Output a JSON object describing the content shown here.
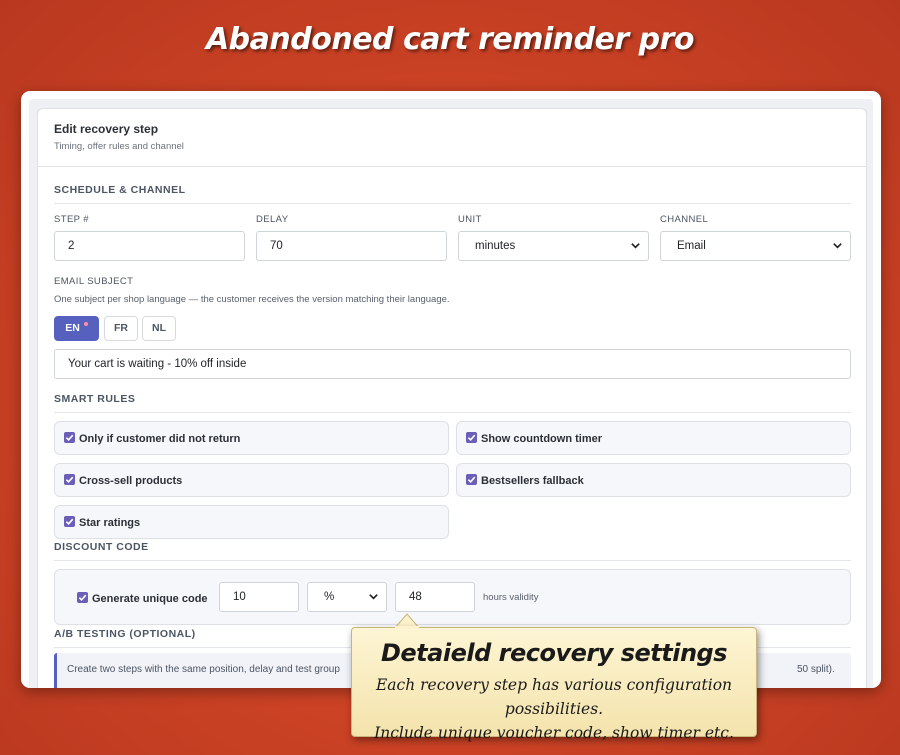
{
  "banner": {
    "title": "Abandoned cart reminder pro"
  },
  "panel": {
    "title": "Edit recovery step",
    "subtitle": "Timing, offer rules and channel"
  },
  "schedule": {
    "section_title": "SCHEDULE & CHANNEL",
    "step_label": "STEP #",
    "step_value": "2",
    "delay_label": "DELAY",
    "delay_value": "70",
    "unit_label": "UNIT",
    "unit_value": "minutes",
    "channel_label": "CHANNEL",
    "channel_value": "Email"
  },
  "email_subject": {
    "label": "EMAIL SUBJECT",
    "help": "One subject per shop language — the customer receives the version matching their language.",
    "languages": [
      "EN",
      "FR",
      "NL"
    ],
    "active_language": "EN",
    "value": "Your cart is waiting - 10% off inside"
  },
  "smart_rules": {
    "section_title": "SMART RULES",
    "items": [
      {
        "label": "Only if customer did not return",
        "checked": true
      },
      {
        "label": "Show countdown timer",
        "checked": true
      },
      {
        "label": "Cross-sell products",
        "checked": true
      },
      {
        "label": "Bestsellers fallback",
        "checked": true
      },
      {
        "label": "Star ratings",
        "checked": true
      }
    ]
  },
  "discount": {
    "section_title": "DISCOUNT CODE",
    "generate_label": "Generate unique code",
    "generate_checked": true,
    "amount_value": "10",
    "type_value": "%",
    "validity_value": "48",
    "validity_suffix": "hours validity"
  },
  "ab_testing": {
    "section_title": "A/B TESTING (OPTIONAL)",
    "info_text": "Create two steps with the same position, delay and test group",
    "info_tail": "50 split)."
  },
  "callout": {
    "title": "Detaield recovery settings",
    "line1": "Each recovery step has various configuration possibilities.",
    "line2": "Include unique voucher code, show timer etc."
  },
  "colors": {
    "background": "#cf4426",
    "accent": "#5661bf",
    "checkbox": "#6a5fb8",
    "callout": "#f6e8b5"
  },
  "icons": {
    "select": "chevron-down-icon",
    "checkbox": "check-icon"
  }
}
